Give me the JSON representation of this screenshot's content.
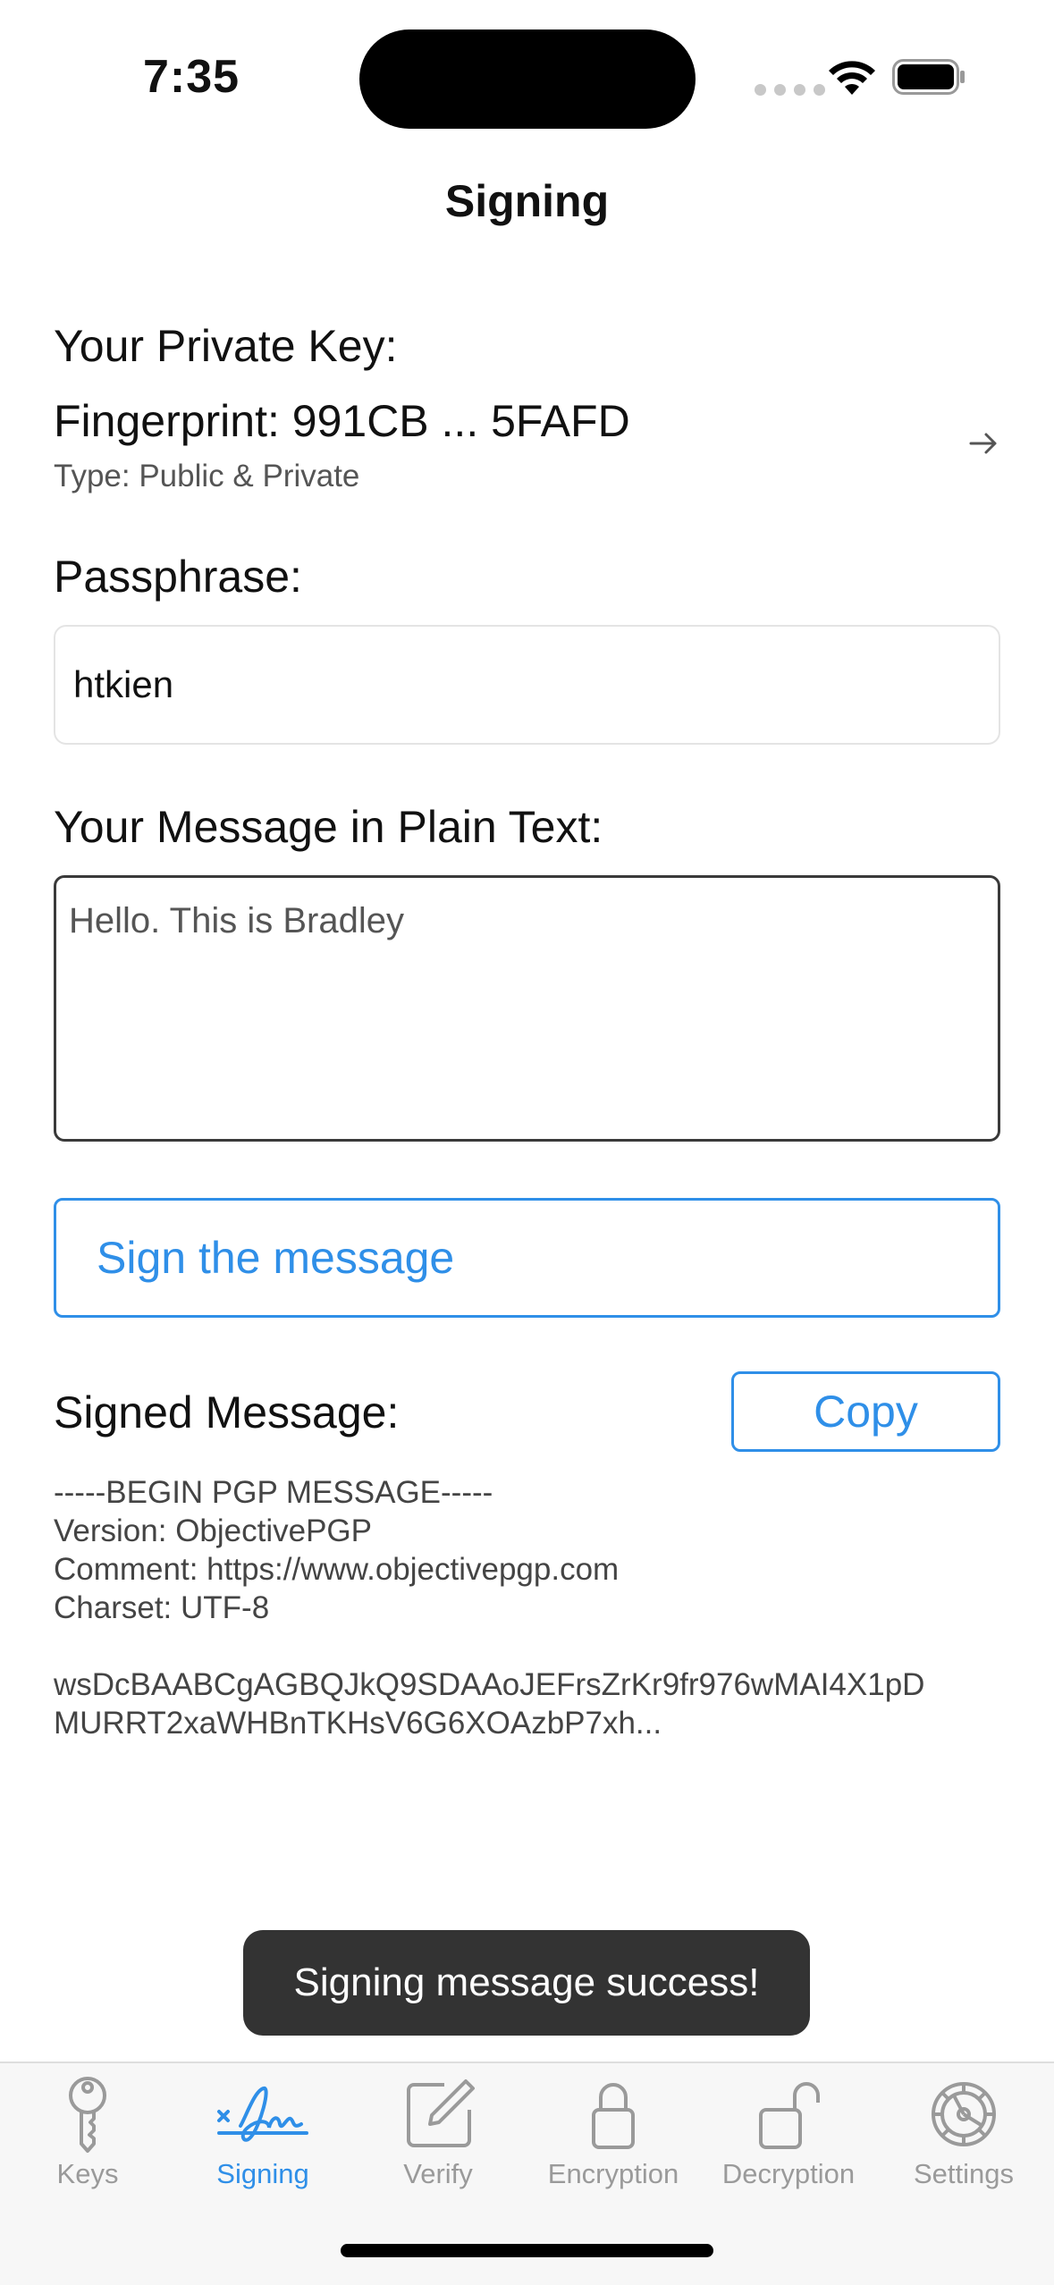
{
  "status_bar": {
    "time": "7:35"
  },
  "nav": {
    "title": "Signing"
  },
  "private_key": {
    "label": "Your Private Key:",
    "fingerprint": "Fingerprint: 991CB ... 5FAFD",
    "type": "Type: Public & Private"
  },
  "passphrase": {
    "label": "Passphrase:",
    "value": "htkien"
  },
  "message": {
    "label": "Your Message in Plain Text:",
    "value": "Hello. This is Bradley"
  },
  "sign_button": {
    "label": "Sign the message"
  },
  "signed": {
    "label": "Signed Message:",
    "copy_label": "Copy",
    "output": "-----BEGIN PGP MESSAGE-----\nVersion: ObjectivePGP\nComment: https://www.objectivepgp.com\nCharset: UTF-8\n\nwsDcBAABCgAGBQJkQ9SDAAoJEFrsZrKr9fr976wMAI4X1pD\nMURRT2xaWHBnTKHsV6G6XOAzbP7xh..."
  },
  "toast": {
    "text": "Signing message success!"
  },
  "tabs": [
    {
      "label": "Keys",
      "icon": "key-icon",
      "active": false
    },
    {
      "label": "Signing",
      "icon": "signature-icon",
      "active": true
    },
    {
      "label": "Verify",
      "icon": "edit-square-icon",
      "active": false
    },
    {
      "label": "Encryption",
      "icon": "lock-icon",
      "active": false
    },
    {
      "label": "Decryption",
      "icon": "unlock-icon",
      "active": false
    },
    {
      "label": "Settings",
      "icon": "gear-icon",
      "active": false
    }
  ],
  "colors": {
    "accent": "#2f8fe8",
    "inactive_tab": "#9a9a9a",
    "toast_bg": "#333333"
  }
}
